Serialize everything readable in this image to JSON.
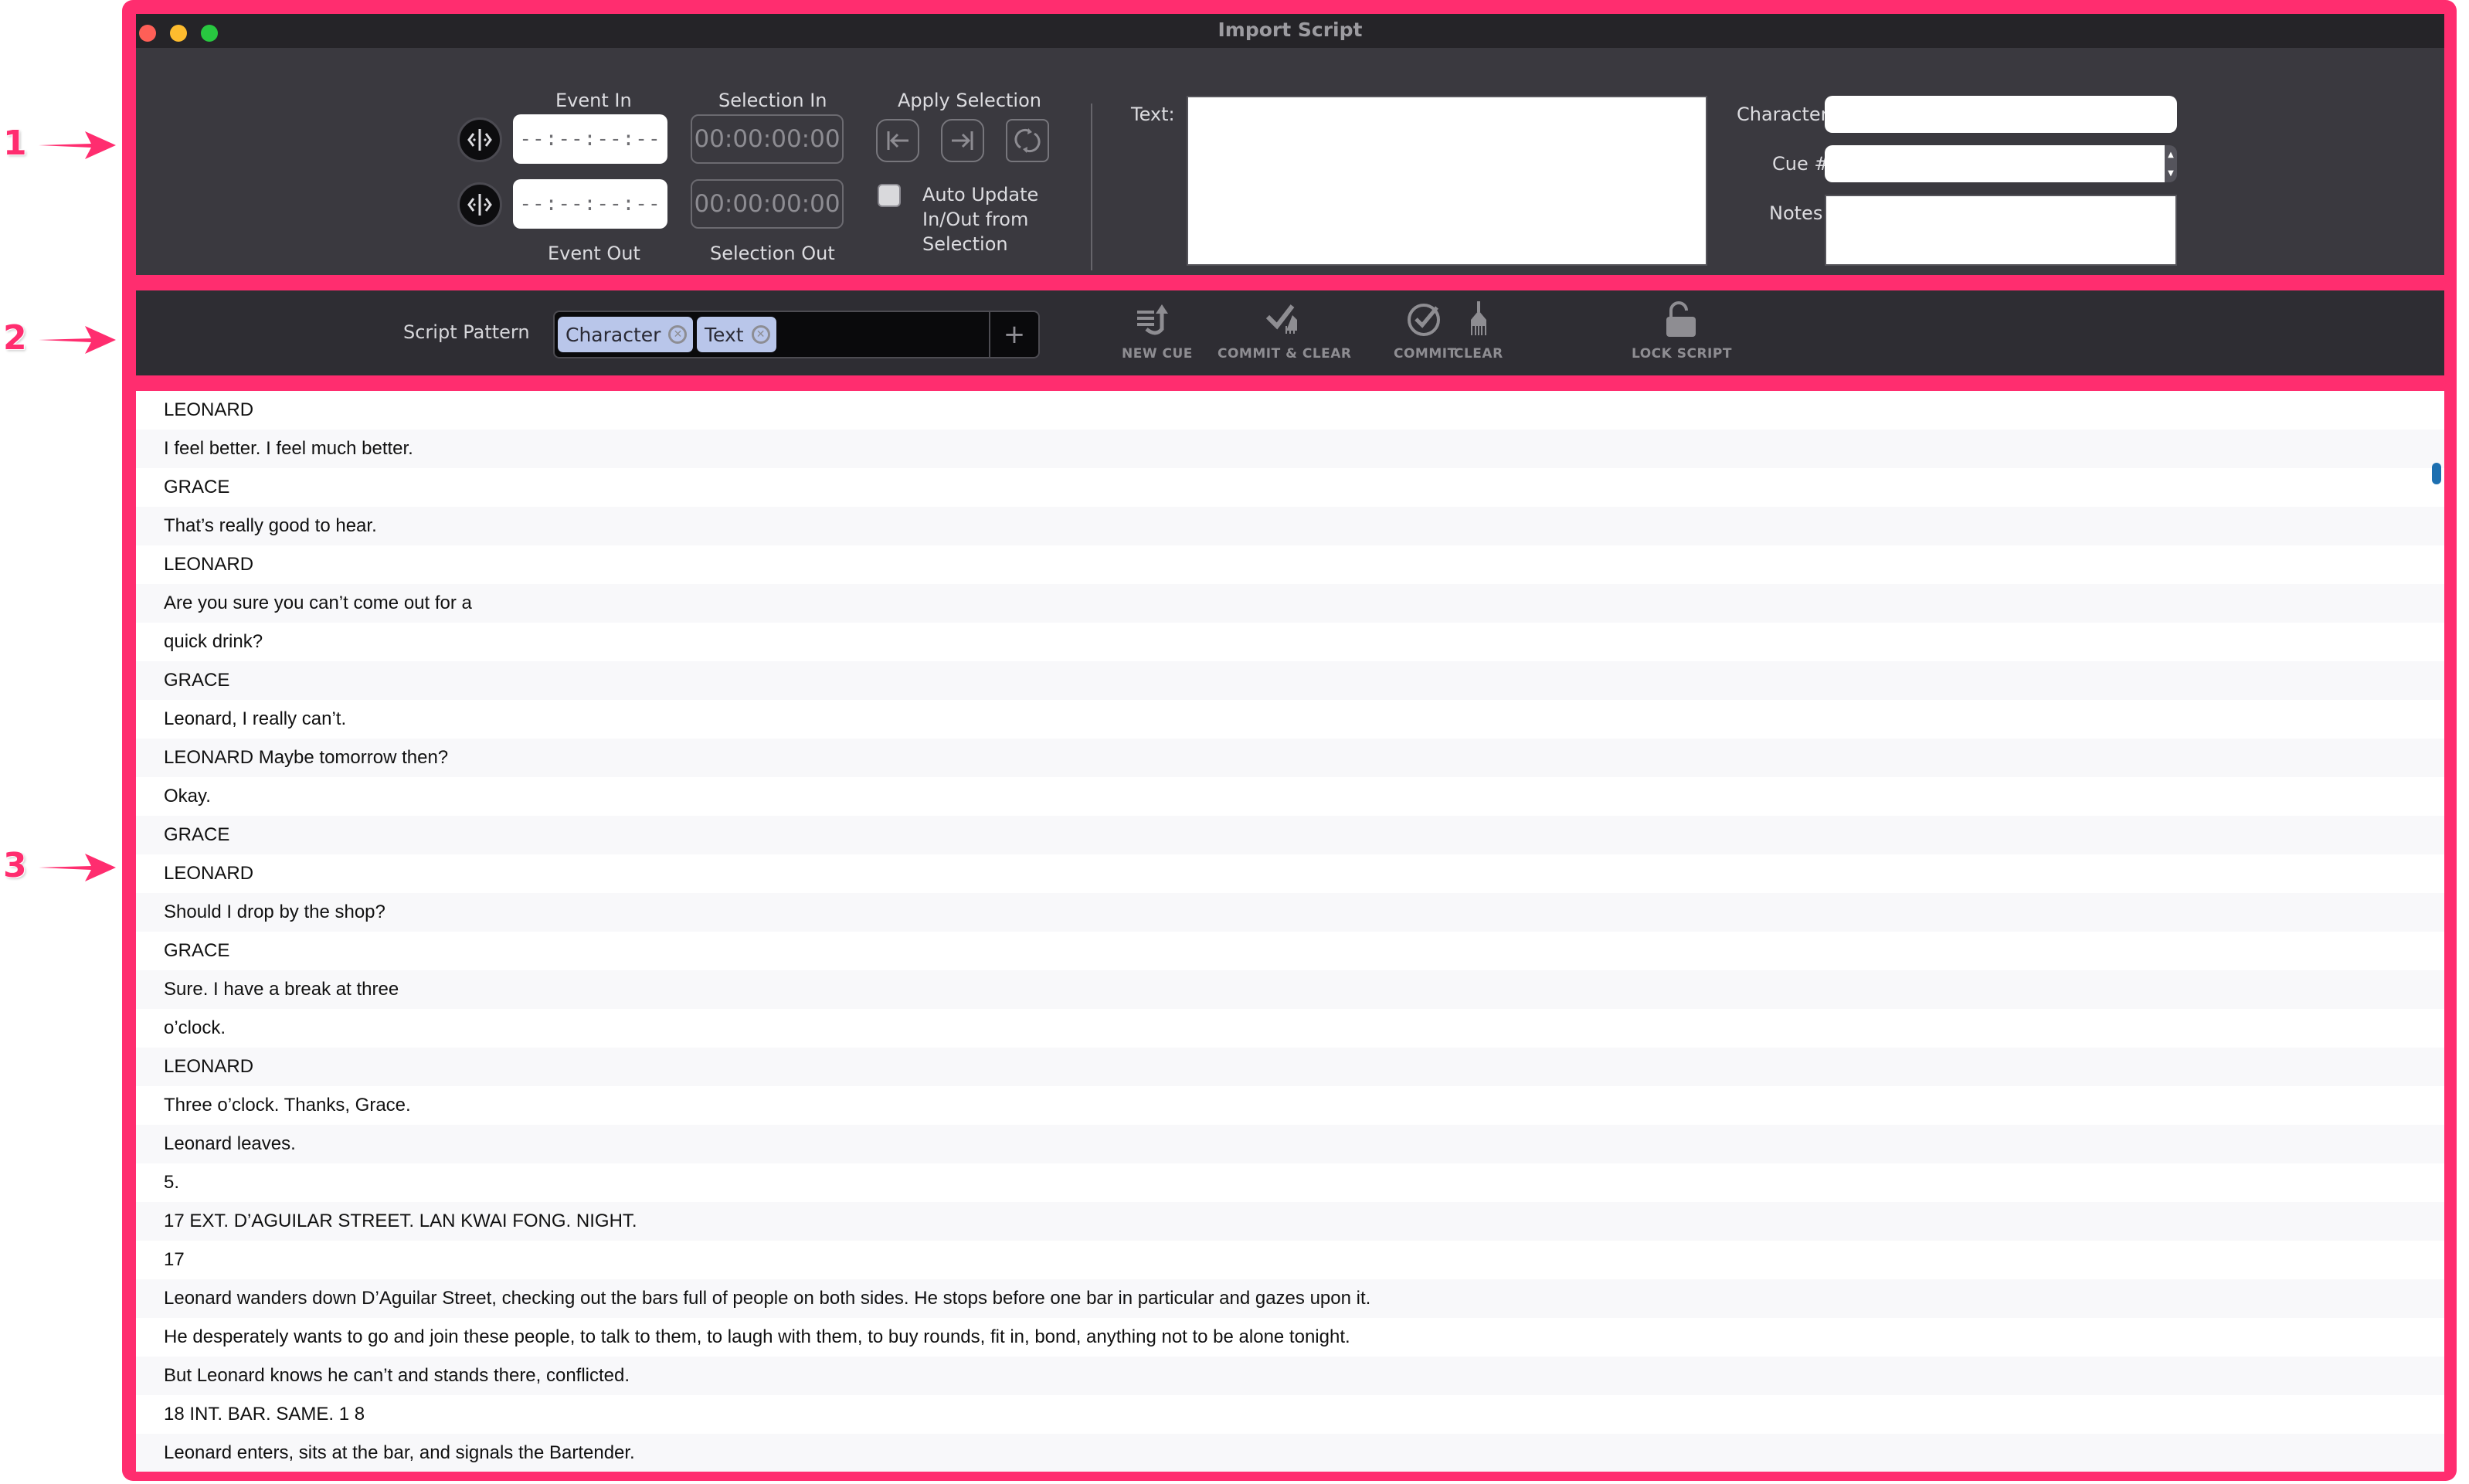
{
  "annotations": [
    "1",
    "2",
    "3"
  ],
  "window": {
    "title": "Import Script",
    "traffic_lights": [
      "close",
      "minimize",
      "zoom"
    ]
  },
  "timecode_panel": {
    "event_in_label": "Event In",
    "event_out_label": "Event Out",
    "event_in_value": "--:--:--:--",
    "event_out_value": "--:--:--:--",
    "selection_in_label": "Selection In",
    "selection_out_label": "Selection Out",
    "selection_in_value": "00:00:00:00",
    "selection_out_value": "00:00:00:00",
    "apply_selection_label": "Apply Selection",
    "auto_update_label_lines": [
      "Auto Update",
      "In/Out from",
      "Selection"
    ],
    "auto_update_checked": false
  },
  "cue_fields": {
    "text_label": "Text:",
    "text_value": "",
    "character_label": "Character:",
    "character_value": "",
    "cue_label": "Cue #:",
    "cue_value": "",
    "notes_label": "Notes:",
    "notes_value": ""
  },
  "toolbar": {
    "script_pattern_label": "Script Pattern",
    "pattern_tokens": [
      "Character",
      "Text"
    ],
    "add_token_label": "+",
    "buttons": [
      {
        "label": "NEW CUE",
        "icon": "new-cue-icon"
      },
      {
        "label": "COMMIT & CLEAR",
        "icon": "commit-clear-icon"
      },
      {
        "label": "COMMIT",
        "icon": "commit-icon"
      },
      {
        "label": "CLEAR",
        "icon": "broom-icon"
      },
      {
        "label": "LOCK SCRIPT",
        "icon": "unlock-icon"
      }
    ]
  },
  "script_lines": [
    "LEONARD",
    "I feel better. I feel much better.",
    "GRACE",
    "That’s really good to hear.",
    "LEONARD",
    "Are you sure you can’t come out for a",
    "quick drink?",
    "GRACE",
    "Leonard, I really can’t.",
    "LEONARD Maybe tomorrow then?",
    "Okay.",
    "GRACE",
    "LEONARD",
    "Should I drop by the shop?",
    "GRACE",
    "Sure. I have a break at three",
    "o’clock.",
    "LEONARD",
    "Three o’clock. Thanks, Grace.",
    "Leonard leaves.",
    "5.",
    "17 EXT. D’AGUILAR STREET. LAN KWAI FONG. NIGHT.",
    "17",
    "Leonard wanders down D’Aguilar Street, checking out the bars full of people on both sides. He stops before one bar in particular and gazes upon it.",
    "He desperately wants to go and join these people, to talk to them, to laugh with them, to buy rounds, fit in, bond, anything not to be alone tonight.",
    "But Leonard knows he can’t and stands there, conflicted.",
    "18 INT. BAR. SAME. 1 8",
    "Leonard enters, sits at the bar, and signals the Bartender."
  ],
  "colors": {
    "annotation": "#ff2d6f",
    "scrollbar": "#1d6fb0",
    "chip": "#b9c6ea"
  }
}
